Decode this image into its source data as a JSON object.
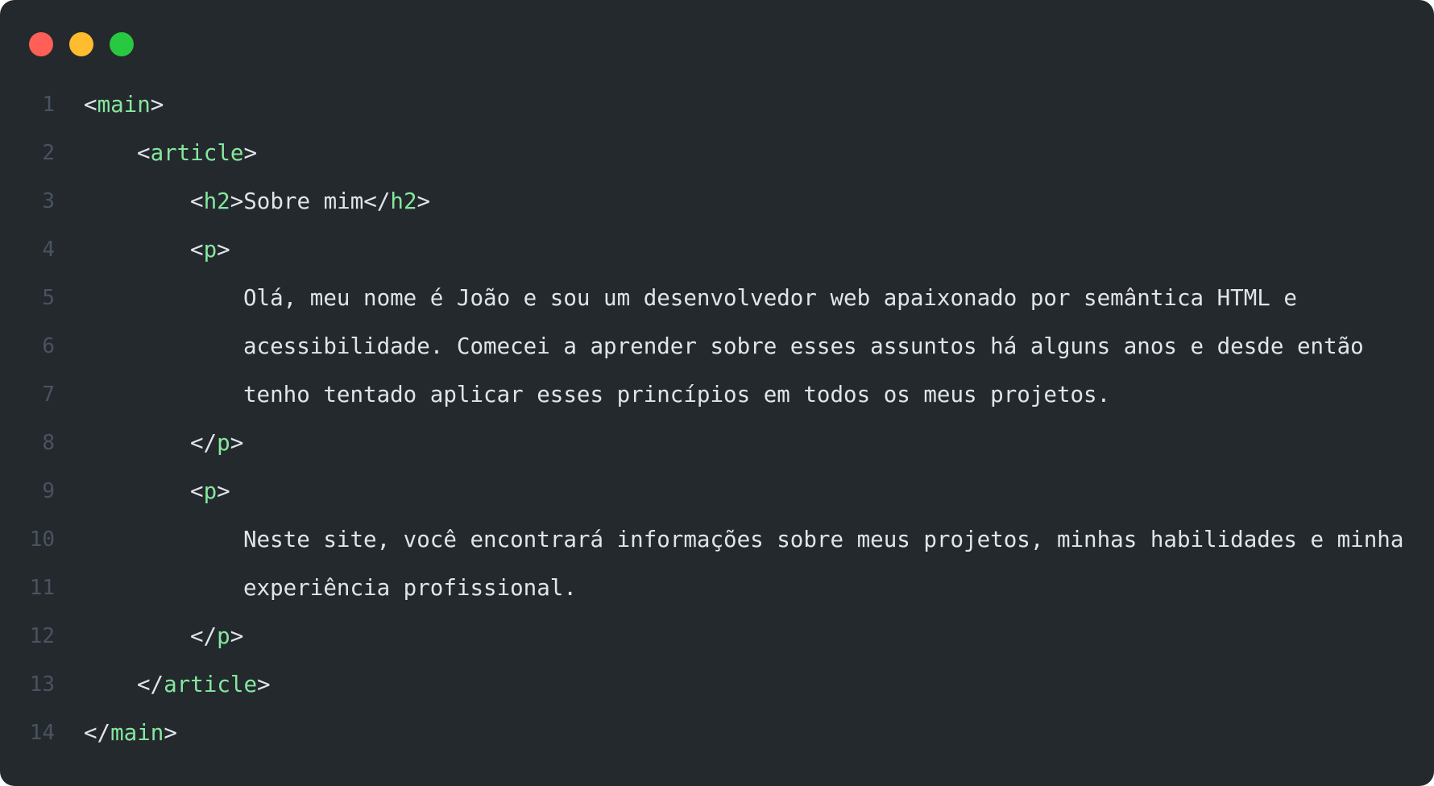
{
  "window": {
    "colors": {
      "background": "#24292e",
      "tag": "#85e89d",
      "text": "#e1e4e8",
      "line_number": "#4a5360"
    },
    "controls": [
      "close",
      "minimize",
      "maximize"
    ]
  },
  "lines": [
    {
      "n": "1",
      "indent": 0,
      "open": "<",
      "tag": "main",
      "close": ">",
      "text": ""
    },
    {
      "n": "2",
      "indent": 1,
      "open": "<",
      "tag": "article",
      "close": ">",
      "text": ""
    },
    {
      "n": "3",
      "indent": 2,
      "open": "<",
      "tag": "h2",
      "close": ">",
      "text": "Sobre mim",
      "end_open": "</",
      "end_tag": "h2",
      "end_close": ">"
    },
    {
      "n": "4",
      "indent": 2,
      "open": "<",
      "tag": "p",
      "close": ">",
      "text": ""
    },
    {
      "n": "5",
      "indent": 3,
      "text": "Olá, meu nome é João e sou um desenvolvedor web apaixonado por semântica HTML e"
    },
    {
      "n": "6",
      "indent": 3,
      "text": "acessibilidade. Comecei a aprender sobre esses assuntos há alguns anos e desde então"
    },
    {
      "n": "7",
      "indent": 3,
      "text": "tenho tentado aplicar esses princípios em todos os meus projetos."
    },
    {
      "n": "8",
      "indent": 2,
      "open": "</",
      "tag": "p",
      "close": ">",
      "text": ""
    },
    {
      "n": "9",
      "indent": 2,
      "open": "<",
      "tag": "p",
      "close": ">",
      "text": ""
    },
    {
      "n": "10",
      "indent": 3,
      "text": "Neste site, você encontrará informações sobre meus projetos, minhas habilidades e minha"
    },
    {
      "n": "11",
      "indent": 3,
      "text": "experiência profissional."
    },
    {
      "n": "12",
      "indent": 2,
      "open": "</",
      "tag": "p",
      "close": ">",
      "text": ""
    },
    {
      "n": "13",
      "indent": 1,
      "open": "</",
      "tag": "article",
      "close": ">",
      "text": ""
    },
    {
      "n": "14",
      "indent": 0,
      "open": "</",
      "tag": "main",
      "close": ">",
      "text": ""
    }
  ]
}
